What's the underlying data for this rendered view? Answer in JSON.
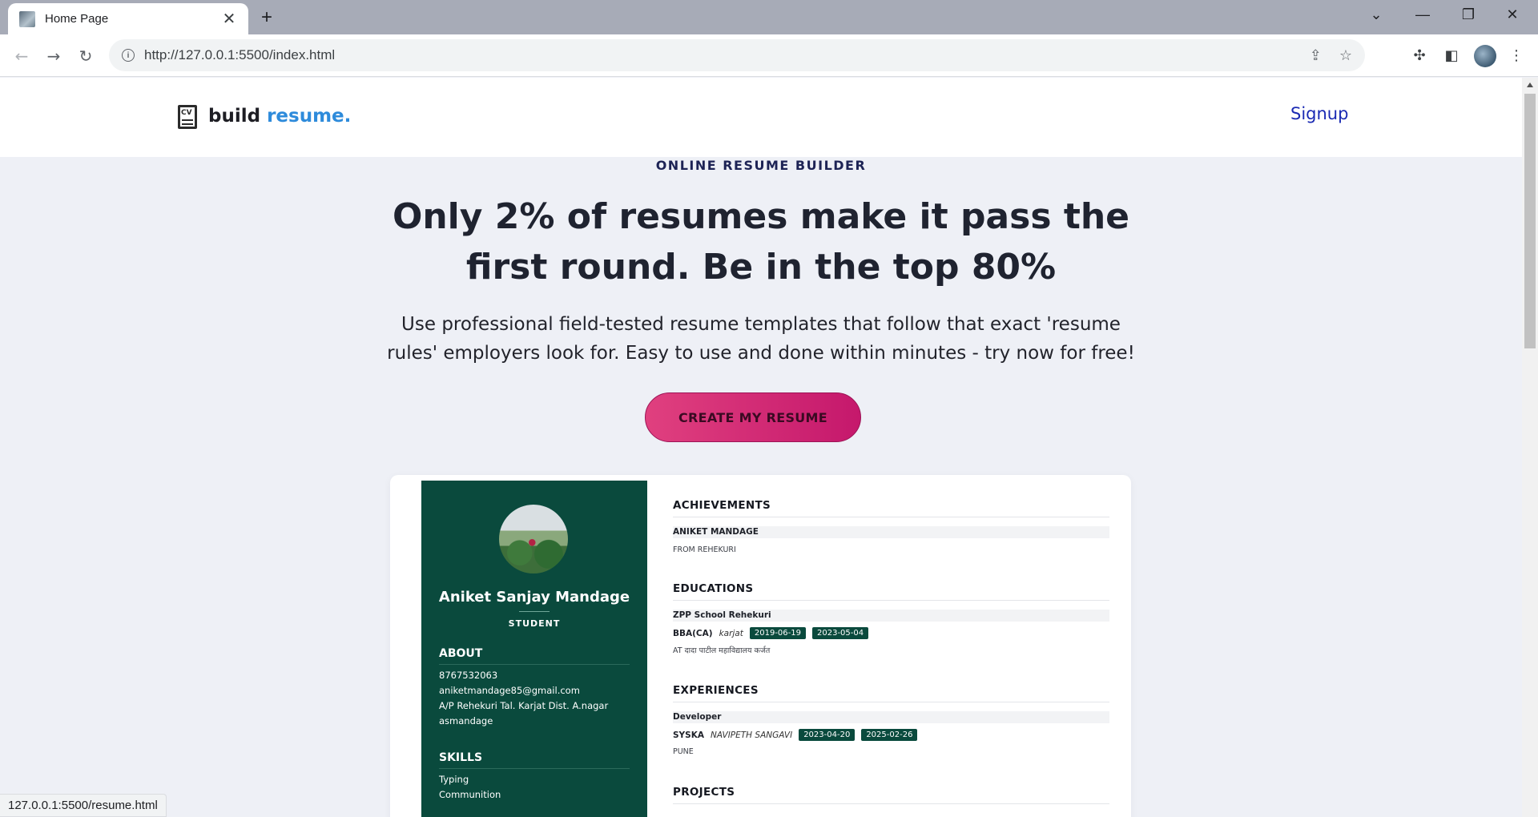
{
  "browser": {
    "tab_title": "Home Page",
    "tab_close": "✕",
    "new_tab": "+",
    "url": "http://127.0.0.1:5500/index.html",
    "status_url": "127.0.0.1:5500/resume.html"
  },
  "header": {
    "logo_word": "build ",
    "logo_accent": "resume.",
    "logo_icon_text": "CV",
    "signup": "Signup"
  },
  "hero": {
    "eyebrow": "ONLINE RESUME BUILDER",
    "title": "Only 2% of resumes make it pass the first round. Be in the top 80%",
    "subtitle": "Use professional field-tested resume templates that follow that exact 'resume rules' employers look for. Easy to use and done within minutes - try now for free!",
    "cta": "CREATE MY RESUME"
  },
  "resume": {
    "name": "Aniket Sanjay Mandage",
    "role": "STUDENT",
    "about_heading": "ABOUT",
    "phone": "8767532063",
    "email": "aniketmandage85@gmail.com",
    "address": "A/P Rehekuri Tal. Karjat Dist. A.nagar",
    "username": "asmandage",
    "skills_heading": "SKILLS",
    "skills": [
      "Typing",
      "Communition"
    ],
    "achievements": {
      "heading": "ACHIEVEMENTS",
      "title": "ANIKET MANDAGE",
      "detail": "FROM REHEKURI"
    },
    "educations": {
      "heading": "EDUCATIONS",
      "school": "ZPP School Rehekuri",
      "degree": "BBA(CA)",
      "place": "karjat",
      "start": "2019-06-19",
      "end": "2023-05-04",
      "detail": "AT दादा पाटील महाविद्यालय कर्जत"
    },
    "experiences": {
      "heading": "EXPERIENCES",
      "title": "Developer",
      "company": "SYSKA",
      "place": "NAVIPETH SANGAVI",
      "start": "2023-04-20",
      "end": "2025-02-26",
      "detail": "PUNE"
    },
    "projects": {
      "heading": "PROJECTS"
    }
  },
  "colors": {
    "brand_accent": "#2e8bdb",
    "cta_gradient_start": "#e0407f",
    "cta_gradient_end": "#c5186c",
    "resume_sidebar": "#0a4a3d"
  }
}
